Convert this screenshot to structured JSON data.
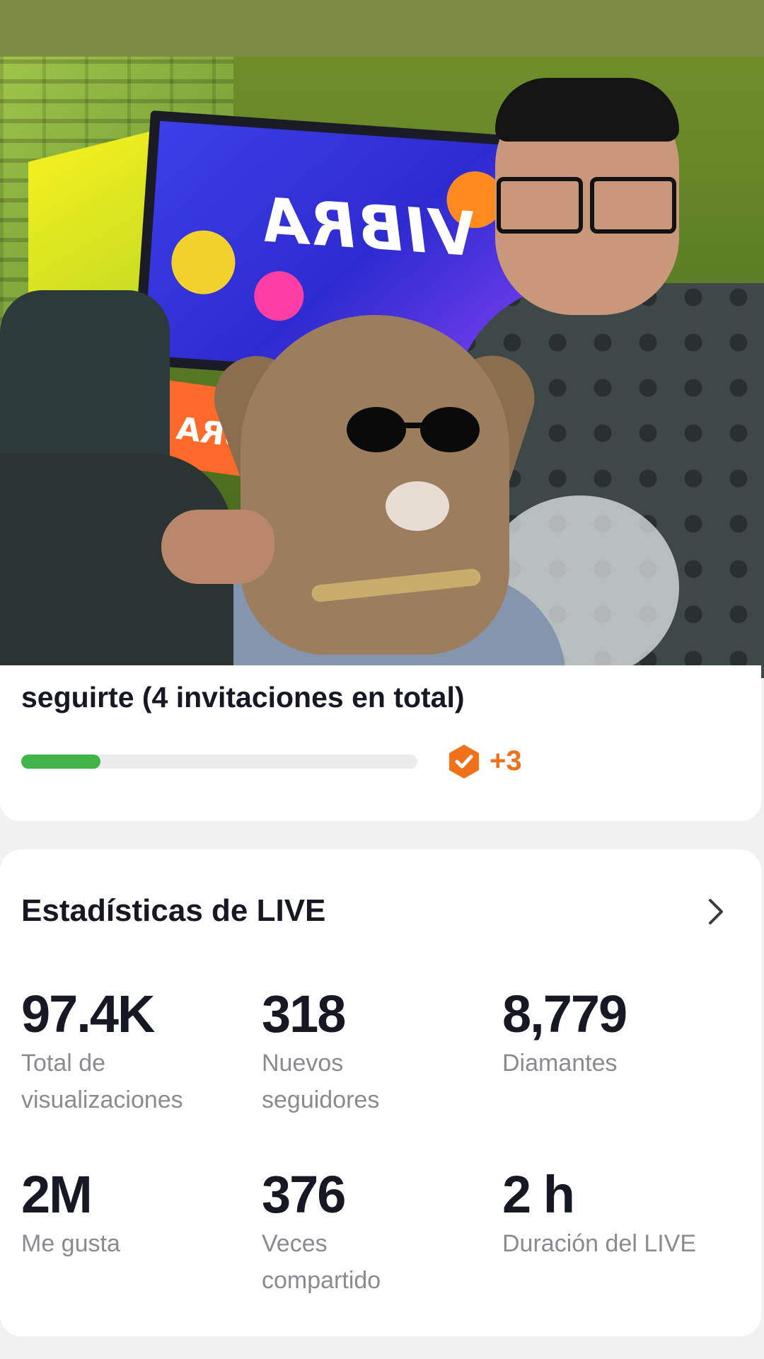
{
  "invite": {
    "description": "seguirte (4 invitaciones en total)",
    "progress_fraction": 0.2,
    "reward": "+3"
  },
  "stats": {
    "title": "Estadísticas de LIVE",
    "items": [
      {
        "value": "97.4K",
        "label": "Total de visualizaciones"
      },
      {
        "value": "318",
        "label": "Nuevos seguidores"
      },
      {
        "value": "8,779",
        "label": "Diamantes"
      },
      {
        "value": "2M",
        "label": "Me gusta"
      },
      {
        "value": "376",
        "label": "Veces compartido"
      },
      {
        "value": "2 h",
        "label": "Duración del LIVE"
      }
    ]
  },
  "overlay": {
    "tv_logo": "VIBRA",
    "colors": {
      "progress": "#41b347",
      "accent": "#f0711a",
      "topbar": "#7d8c45"
    }
  }
}
